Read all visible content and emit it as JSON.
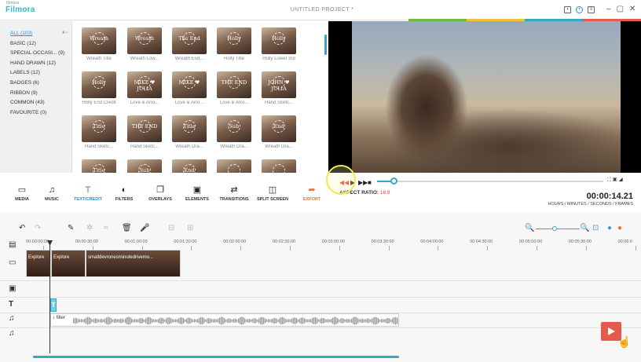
{
  "app": {
    "logo": "Filmora",
    "logo_top": "filmora",
    "project_title": "UNTITLED PROJECT *",
    "window_controls": [
      "–",
      "▢",
      "✕"
    ]
  },
  "categories": [
    {
      "label": "ALL (103)",
      "active": true
    },
    {
      "label": "BASIC (12)"
    },
    {
      "label": "SPECIAL OCCASI... (9)"
    },
    {
      "label": "HAND DRAWN (12)"
    },
    {
      "label": "LABELS (12)"
    },
    {
      "label": "BADGES (6)"
    },
    {
      "label": "RIBBON (9)"
    },
    {
      "label": "COMMON (43)"
    },
    {
      "label": "FAVOURITE (0)"
    }
  ],
  "thumbnails": [
    {
      "label": "Wreath Title",
      "art": "Wreath"
    },
    {
      "label": "Wreath Low...",
      "art": "Wreath"
    },
    {
      "label": "Wreath End...",
      "art": "The End"
    },
    {
      "label": "Holly Title",
      "art": "Holly"
    },
    {
      "label": "Holly Lower 3rd",
      "art": "Holly"
    },
    {
      "label": "Holly End Credit",
      "art": "Holly"
    },
    {
      "label": "Love & Arro...",
      "art": "MIKE ♥ JULIA"
    },
    {
      "label": "Love & Arro...",
      "art": "MIKE ♥"
    },
    {
      "label": "Love & Arro...",
      "art": "THE END"
    },
    {
      "label": "Hand Sketc...",
      "art": "JOHN ♥ JULIA"
    },
    {
      "label": "Hand Sketc...",
      "art": "Title"
    },
    {
      "label": "Hand Sketc...",
      "art": "THE END"
    },
    {
      "label": "Wreath Dra...",
      "art": "Title"
    },
    {
      "label": "Wreath Dra...",
      "art": "Sub"
    },
    {
      "label": "Wreath Dra...",
      "art": "End"
    },
    {
      "label": "",
      "art": "Title"
    },
    {
      "label": "",
      "art": "Sub"
    },
    {
      "label": "",
      "art": "End"
    },
    {
      "label": "",
      "art": ""
    },
    {
      "label": "",
      "art": ""
    }
  ],
  "toolbar": [
    {
      "label": "MEDIA",
      "icon": "▭"
    },
    {
      "label": "MUSIC",
      "icon": "♫"
    },
    {
      "label": "TEXT/CREDIT",
      "icon": "T",
      "active": true
    },
    {
      "label": "FILTERS",
      "icon": "◐"
    },
    {
      "label": "OVERLAYS",
      "icon": "❐"
    },
    {
      "label": "ELEMENTS",
      "icon": "▣"
    },
    {
      "label": "TRANSITIONS",
      "icon": "⇄"
    },
    {
      "label": "SPLIT SCREEN",
      "icon": "◫"
    },
    {
      "label": "EXPORT",
      "icon": "➦",
      "export": true
    }
  ],
  "player": {
    "aspect_label": "ASPECT RATIO:",
    "aspect_value": "16:9",
    "timecode": "00:00:14.21",
    "timecode_label": "HOURS / MINUTES / SECONDS / FRAMES",
    "progress": 0.07
  },
  "ruler": [
    "00:00:00:00",
    "00:00:30:00",
    "00:01:00:00",
    "00:01:30:00",
    "00:02:00:00",
    "00:02:30:00",
    "00:03:00:00",
    "00:03:30:00",
    "00:04:00:00",
    "00:04:30:00",
    "00:05:00:00",
    "00:05:30:00",
    "00:06:0"
  ],
  "clips": [
    "Explore",
    "Explore",
    "smalldevronesminutedrivemo..."
  ],
  "audio_label": "♪ filter",
  "colors": {
    "accent": "#3aa5c5",
    "blue": "#1e8fd0",
    "red": "#e0443a",
    "export": "#e9703a"
  }
}
